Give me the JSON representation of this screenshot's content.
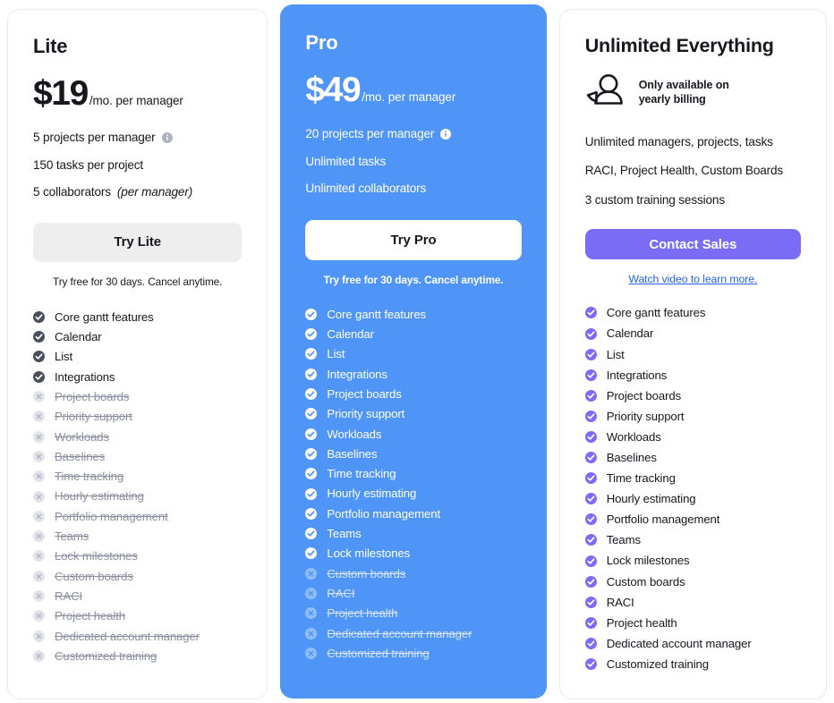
{
  "theme": {
    "pro_bg": "#4f95f7",
    "purple": "#7b6cf6",
    "link_blue": "#2563eb",
    "check_dark": "#4a4f5c",
    "check_purple": "#7b6cf6",
    "check_white": "#ffffff",
    "disabled_gray": "#c9ccd4"
  },
  "plans": [
    {
      "id": "lite",
      "name": "Lite",
      "price_amount": "$19",
      "price_period": "/mo. per manager",
      "specs": [
        {
          "text": "5 projects per manager",
          "info": true
        },
        {
          "text": "150 tasks per project",
          "info": false
        },
        {
          "text": "5 collaborators",
          "italic": "(per manager)",
          "info": false
        }
      ],
      "cta_label": "Try Lite",
      "cta_caption": "Try free for 30 days. Cancel anytime.",
      "features": [
        {
          "label": "Core gantt features",
          "included": true
        },
        {
          "label": "Calendar",
          "included": true
        },
        {
          "label": "List",
          "included": true
        },
        {
          "label": "Integrations",
          "included": true
        },
        {
          "label": "Project boards",
          "included": false
        },
        {
          "label": "Priority support",
          "included": false
        },
        {
          "label": "Workloads",
          "included": false
        },
        {
          "label": "Baselines",
          "included": false
        },
        {
          "label": "Time tracking",
          "included": false
        },
        {
          "label": "Hourly estimating",
          "included": false
        },
        {
          "label": "Portfolio management",
          "included": false
        },
        {
          "label": "Teams",
          "included": false
        },
        {
          "label": "Lock milestones",
          "included": false
        },
        {
          "label": "Custom boards",
          "included": false
        },
        {
          "label": "RACI",
          "included": false
        },
        {
          "label": "Project health",
          "included": false
        },
        {
          "label": "Dedicated account manager",
          "included": false
        },
        {
          "label": "Customized training",
          "included": false
        }
      ]
    },
    {
      "id": "pro",
      "name": "Pro",
      "price_amount": "$49",
      "price_period": "/mo. per manager",
      "specs": [
        {
          "text": "20 projects per manager",
          "info": true
        },
        {
          "text": "Unlimited tasks",
          "info": false
        },
        {
          "text": "Unlimited collaborators",
          "info": false
        }
      ],
      "cta_label": "Try Pro",
      "cta_caption": "Try free for 30 days. Cancel anytime.",
      "features": [
        {
          "label": "Core gantt features",
          "included": true
        },
        {
          "label": "Calendar",
          "included": true
        },
        {
          "label": "List",
          "included": true
        },
        {
          "label": "Integrations",
          "included": true
        },
        {
          "label": "Project boards",
          "included": true
        },
        {
          "label": "Priority support",
          "included": true
        },
        {
          "label": "Workloads",
          "included": true
        },
        {
          "label": "Baselines",
          "included": true
        },
        {
          "label": "Time tracking",
          "included": true
        },
        {
          "label": "Hourly estimating",
          "included": true
        },
        {
          "label": "Portfolio management",
          "included": true
        },
        {
          "label": "Teams",
          "included": true
        },
        {
          "label": "Lock milestones",
          "included": true
        },
        {
          "label": "Custom boards",
          "included": false
        },
        {
          "label": "RACI",
          "included": false
        },
        {
          "label": "Project health",
          "included": false
        },
        {
          "label": "Dedicated account manager",
          "included": false
        },
        {
          "label": "Customized training",
          "included": false
        }
      ]
    },
    {
      "id": "unlimited",
      "name": "Unlimited Everything",
      "badge_note": "Only available on\nyearly billing",
      "specs": [
        {
          "text": "Unlimited managers, projects, tasks",
          "info": false
        },
        {
          "text": "RACI, Project Health, Custom Boards",
          "info": false
        },
        {
          "text": "3 custom training sessions",
          "info": false
        }
      ],
      "cta_label": "Contact Sales",
      "cta_link": "Watch video to learn more.",
      "features": [
        {
          "label": "Core gantt features",
          "included": true
        },
        {
          "label": "Calendar",
          "included": true
        },
        {
          "label": "List",
          "included": true
        },
        {
          "label": "Integrations",
          "included": true
        },
        {
          "label": "Project boards",
          "included": true
        },
        {
          "label": "Priority support",
          "included": true
        },
        {
          "label": "Workloads",
          "included": true
        },
        {
          "label": "Baselines",
          "included": true
        },
        {
          "label": "Time tracking",
          "included": true
        },
        {
          "label": "Hourly estimating",
          "included": true
        },
        {
          "label": "Portfolio management",
          "included": true
        },
        {
          "label": "Teams",
          "included": true
        },
        {
          "label": "Lock milestones",
          "included": true
        },
        {
          "label": "Custom boards",
          "included": true
        },
        {
          "label": "RACI",
          "included": true
        },
        {
          "label": "Project health",
          "included": true
        },
        {
          "label": "Dedicated account manager",
          "included": true
        },
        {
          "label": "Customized training",
          "included": true
        }
      ]
    }
  ],
  "icons": {
    "info": "info-icon",
    "check": "check-circle-icon",
    "cross": "x-circle-icon",
    "person": "person-contact-icon"
  }
}
